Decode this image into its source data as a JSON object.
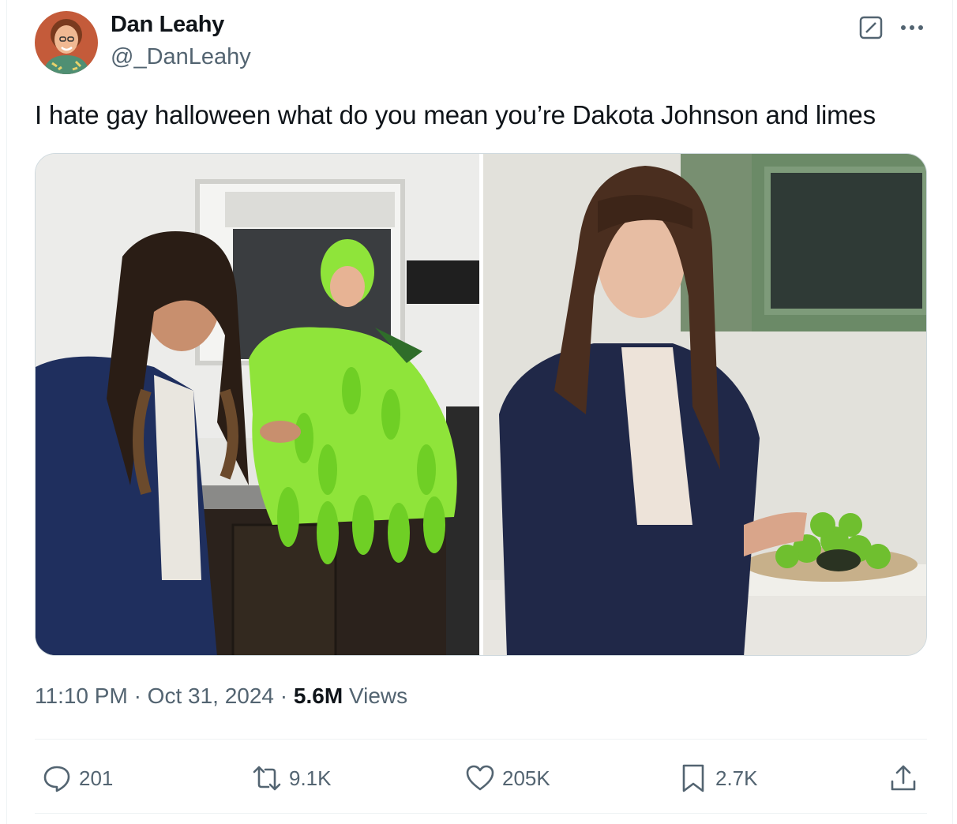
{
  "tweet": {
    "display_name": "Dan Leahy",
    "handle": "@_DanLeahy",
    "text": "I hate gay halloween what do you mean you’re Dakota Johnson and limes",
    "time": "11:10 PM",
    "date": "Oct 31, 2024",
    "separator": "·",
    "views_count": "5.6M",
    "views_label": "Views"
  },
  "actions": {
    "replies": "201",
    "reposts": "9.1K",
    "likes": "205K",
    "bookmarks": "2.7K"
  },
  "icons": [
    "grok-icon",
    "more-icon",
    "reply-icon",
    "repost-icon",
    "like-icon",
    "bookmark-icon",
    "share-icon"
  ],
  "colors": {
    "text": "#0f1419",
    "secondary": "#536471",
    "border": "#cfd9de",
    "divider": "#eff3f4"
  }
}
